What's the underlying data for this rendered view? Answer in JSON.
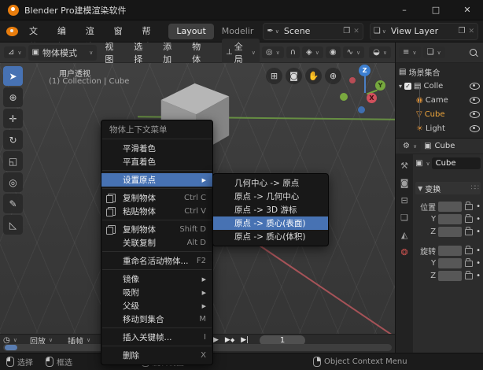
{
  "window": {
    "title": "Blender Pro建模渲染软件"
  },
  "menubar": {
    "menus": [
      "文件",
      "编辑",
      "渲染",
      "窗口",
      "帮助"
    ],
    "tab_active": "Layout",
    "tab_next": "Modelir",
    "scene_value": "Scene",
    "view_layer_value": "View Layer"
  },
  "vheader": {
    "mode": "物体模式",
    "menus": [
      "视图",
      "选择",
      "添加",
      "物体"
    ],
    "orientation": "全局"
  },
  "viewport": {
    "view_name": "用户透视",
    "breadcrumb": "(1) Collection | Cube",
    "axis_z": "Z",
    "axis_y": "Y",
    "axis_x": "X"
  },
  "context_menu": {
    "title": "物体上下文菜单",
    "items": [
      {
        "label": "平滑着色",
        "shortcut": ""
      },
      {
        "label": "平直着色",
        "shortcut": ""
      },
      {
        "label": "设置原点",
        "shortcut": ""
      },
      {
        "label": "复制物体",
        "shortcut": "Ctrl C"
      },
      {
        "label": "粘贴物体",
        "shortcut": "Ctrl V"
      },
      {
        "label": "复制物体",
        "shortcut": "Shift D"
      },
      {
        "label": "关联复制",
        "shortcut": "Alt D"
      },
      {
        "label": "重命名活动物体...",
        "shortcut": "F2"
      },
      {
        "label": "镜像",
        "shortcut": ""
      },
      {
        "label": "吸附",
        "shortcut": ""
      },
      {
        "label": "父级",
        "shortcut": ""
      },
      {
        "label": "移动到集合",
        "shortcut": "M"
      },
      {
        "label": "插入关键帧...",
        "shortcut": "I"
      },
      {
        "label": "删除",
        "shortcut": "X"
      }
    ]
  },
  "origin_submenu": {
    "items": [
      {
        "label": "几何中心 -> 原点"
      },
      {
        "label": "原点 -> 几何中心"
      },
      {
        "label": "原点 -> 3D 游标"
      },
      {
        "label": "原点 -> 质心(表面)"
      },
      {
        "label": "原点 -> 质心(体积)"
      }
    ]
  },
  "outliner": {
    "scene_collection": "场景集合",
    "collection": "Colle",
    "camera": "Came",
    "cube": "Cube",
    "light": "Light"
  },
  "properties": {
    "breadcrumb_object": "Cube",
    "object_name": "Cube",
    "panel_title": "变换",
    "row_labels": [
      "位置",
      "Y",
      "Z",
      "旋转",
      "Y",
      "Z"
    ]
  },
  "timeline": {
    "playback": "回放",
    "keying": "插帧",
    "frame": "1"
  },
  "statusbar": {
    "select": "选择",
    "box_select": "框选",
    "rotate_view": "旋转视图",
    "context_menu": "Object Context Menu"
  },
  "colors": {
    "accent": "#4772b3",
    "selection_orange": "#f0a73c",
    "brand_orange": "#e87d0d"
  },
  "icons": {
    "minimize": "–",
    "maximize": "□",
    "close": "✕",
    "chevron": "∨",
    "submenu_arrow": "▶",
    "panel_collapse": "▼",
    "disclosure": "▾",
    "check": "✓",
    "dot": "•",
    "panel_drag": "∷∷",
    "tool_select": "➤",
    "tool_cursor": "⊕",
    "tool_move": "✛",
    "tool_rotate": "↻",
    "tool_scale": "◱",
    "tool_transform": "◎",
    "tool_annotate": "✎",
    "tool_measure": "◺",
    "nav_grid": "⊞",
    "nav_camera": "◙",
    "nav_pan": "✋",
    "nav_zoom": "⊕",
    "editor_3d": "⊿",
    "mode_object": "▣",
    "orientation_axes": "⊥",
    "pivot": "◎",
    "magnet": "∩",
    "snap_target": "◈",
    "proportional": "◉",
    "falloff": "∿",
    "overlays": "◒",
    "editor_outliner": "≡",
    "filter": "❏",
    "outliner_collection": "▤",
    "outliner_camera": "◉",
    "outliner_cube": "▽",
    "outliner_light": "☀",
    "editor_props": "⚙",
    "breadcrumb_obj": "▣",
    "tab_tool": "⚒",
    "tab_render": "◙",
    "tab_output": "⊟",
    "tab_viewlayer": "❏",
    "tab_scene": "◭",
    "tab_world": "❂",
    "editor_timeline": "◷",
    "play": "▶",
    "diamond": "◆",
    "bar": "|",
    "scene_widget": "✒",
    "viewlayer_widget": "❏",
    "copy_badge": "❐"
  }
}
